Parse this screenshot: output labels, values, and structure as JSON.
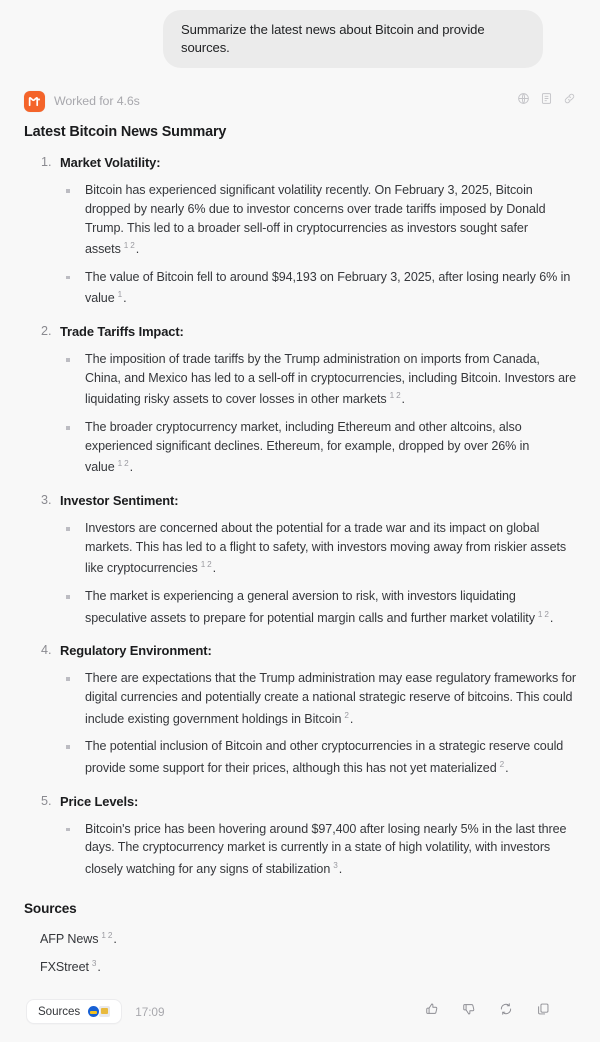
{
  "user_message": {
    "text": "Summarize the latest news about Bitcoin and provide sources."
  },
  "assistant": {
    "brand_name": "monica-logo-icon",
    "worked_label": "Worked for 4.6s",
    "doc_title": "Latest Bitcoin News Summary",
    "header_actions": [
      {
        "name": "translate-globe-icon",
        "label": "Translate"
      },
      {
        "name": "copy-document-icon",
        "label": "Copy document"
      },
      {
        "name": "link-icon",
        "label": "Copy link"
      }
    ],
    "sections": [
      {
        "number": "1.",
        "title": "Market Volatility:",
        "points": [
          {
            "text": "Bitcoin has experienced significant volatility recently. On February 3, 2025, Bitcoin dropped by nearly 6% due to investor concerns over trade tariffs imposed by Donald Trump. This led to a broader sell-off in cryptocurrencies as investors sought safer assets",
            "citations": [
              "1",
              "2"
            ],
            "tail": "."
          },
          {
            "text": "The value of Bitcoin fell to around $94,193 on February 3, 2025, after losing nearly 6% in value",
            "citations": [
              "1"
            ],
            "tail": "."
          }
        ]
      },
      {
        "number": "2.",
        "title": "Trade Tariffs Impact:",
        "points": [
          {
            "text": "The imposition of trade tariffs by the Trump administration on imports from Canada, China, and Mexico has led to a sell-off in cryptocurrencies, including Bitcoin. Investors are liquidating risky assets to cover losses in other markets",
            "citations": [
              "1",
              "2"
            ],
            "tail": "."
          },
          {
            "text": "The broader cryptocurrency market, including Ethereum and other altcoins, also experienced significant declines. Ethereum, for example, dropped by over 26% in value",
            "citations": [
              "1",
              "2"
            ],
            "tail": "."
          }
        ]
      },
      {
        "number": "3.",
        "title": "Investor Sentiment:",
        "points": [
          {
            "text": "Investors are concerned about the potential for a trade war and its impact on global markets. This has led to a flight to safety, with investors moving away from riskier assets like cryptocurrencies",
            "citations": [
              "1",
              "2"
            ],
            "tail": "."
          },
          {
            "text": "The market is experiencing a general aversion to risk, with investors liquidating speculative assets to prepare for potential margin calls and further market volatility",
            "citations": [
              "1",
              "2"
            ],
            "tail": "."
          }
        ]
      },
      {
        "number": "4.",
        "title": "Regulatory Environment:",
        "points": [
          {
            "text": "There are expectations that the Trump administration may ease regulatory frameworks for digital currencies and potentially create a national strategic reserve of bitcoins. This could include existing government holdings in Bitcoin",
            "citations": [
              "2"
            ],
            "tail": "."
          },
          {
            "text": "The potential inclusion of Bitcoin and other cryptocurrencies in a strategic reserve could provide some support for their prices, although this has not yet materialized",
            "citations": [
              "2"
            ],
            "tail": "."
          }
        ]
      },
      {
        "number": "5.",
        "title": "Price Levels:",
        "points": [
          {
            "text": "Bitcoin's price has been hovering around $97,400 after losing nearly 5% in the last three days. The cryptocurrency market is currently in a state of high volatility, with investors closely watching for any signs of stabilization",
            "citations": [
              "3"
            ],
            "tail": "."
          }
        ]
      }
    ],
    "sources_heading": "Sources",
    "sources": [
      {
        "name": "AFP News",
        "citations": [
          "1",
          "2"
        ],
        "tail": "."
      },
      {
        "name": "FXStreet",
        "citations": [
          "3"
        ],
        "tail": "."
      }
    ]
  },
  "footer": {
    "sources_chip_label": "Sources",
    "timestamp": "17:09",
    "actions": [
      {
        "name": "thumbs-up-icon",
        "label": "Like"
      },
      {
        "name": "thumbs-down-icon",
        "label": "Dislike"
      },
      {
        "name": "regenerate-icon",
        "label": "Regenerate"
      },
      {
        "name": "copy-icon",
        "label": "Copy"
      }
    ]
  },
  "colors": {
    "background": "#f8f8f8",
    "brand_orange": "#f4642a",
    "user_bubble": "#ebebeb",
    "body_text": "#35373b",
    "muted_text": "#a8a8ad"
  }
}
